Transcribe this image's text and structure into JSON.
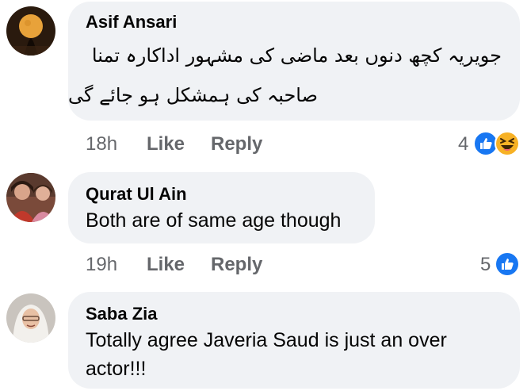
{
  "comments": [
    {
      "author": "Asif Ansari",
      "text_line_1": "جویریہ کچھ دنوں بعد ماضی کی مشہور اداکارہ تمنا",
      "text_line_2": "صاحبہ کی ہمشکل ہو جائے گی",
      "time": "18h",
      "like_label": "Like",
      "reply_label": "Reply",
      "reaction_count": "4",
      "reactions": [
        "like-icon",
        "haha-icon"
      ]
    },
    {
      "author": "Qurat Ul Ain",
      "text": "Both are of same age though",
      "time": "19h",
      "like_label": "Like",
      "reply_label": "Reply",
      "reaction_count": "5",
      "reactions": [
        "like-icon"
      ]
    },
    {
      "author": "Saba Zia",
      "text_line_1": "Totally agree Javeria Saud is just an over",
      "text_line_2": "actor!!!"
    }
  ],
  "colors": {
    "bubble": "#f0f2f5",
    "meta_text": "#65676b",
    "like_blue": "#1877f2",
    "haha_yellow": "#f7b125"
  }
}
